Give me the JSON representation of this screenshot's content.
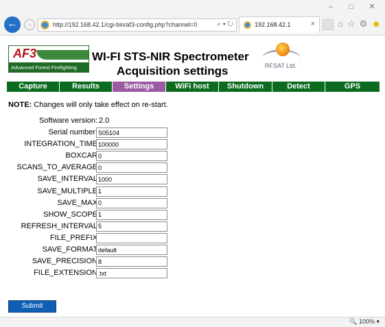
{
  "browser": {
    "url": "http://192.168.42.1/cgi-bin/af3-config.php?channel=0",
    "address_tools": "⌕ ▾ ↻",
    "tab_title": "192.168.42.1",
    "tab_close": "×",
    "window_controls": [
      "–",
      "□",
      "✕"
    ],
    "zoom": "🔍 100%  ▾"
  },
  "header": {
    "logo_left_word": "AF3",
    "logo_left_sub": "Advanced Forest Firefighting",
    "title_line1": "WI-FI STS-NIR Spectrometer",
    "title_line2": "Acquisition settings",
    "logo_right_text": "RFSAT Ltd."
  },
  "nav": {
    "items": [
      {
        "label": "Capture",
        "active": false
      },
      {
        "label": "Results",
        "active": false
      },
      {
        "label": "Settings",
        "active": true
      },
      {
        "label": "WiFi host",
        "active": false
      },
      {
        "label": "Shutdown",
        "active": false
      },
      {
        "label": "Detect",
        "active": false
      },
      {
        "label": "GPS",
        "active": false
      }
    ]
  },
  "note": {
    "bold": "NOTE:",
    "text": " Changes will only take effect on re-start."
  },
  "form": {
    "software_version_label": "Software version:",
    "software_version_value": "2.0",
    "fields": [
      {
        "label": "Serial number:",
        "value": "S05104"
      },
      {
        "label": "INTEGRATION_TIME",
        "value": "100000"
      },
      {
        "label": "BOXCAR",
        "value": "0"
      },
      {
        "label": "SCANS_TO_AVERAGE",
        "value": "0"
      },
      {
        "label": "SAVE_INTERVAL",
        "value": "1000"
      },
      {
        "label": "SAVE_MULTIPLE",
        "value": "1"
      },
      {
        "label": "SAVE_MAX",
        "value": "0"
      },
      {
        "label": "SHOW_SCOPE",
        "value": "1"
      },
      {
        "label": "REFRESH_INTERVAL",
        "value": "5"
      },
      {
        "label": "FILE_PREFIX",
        "value": ""
      },
      {
        "label": "SAVE_FORMAT",
        "value": "default"
      },
      {
        "label": "SAVE_PRECISION",
        "value": "8"
      },
      {
        "label": "FILE_EXTENSION",
        "value": ".txt"
      }
    ],
    "submit_label": "Submit"
  },
  "colors": {
    "nav_green": "#0b6b1e",
    "nav_active": "#9b5aa2",
    "submit_blue": "#0f5fb5"
  }
}
